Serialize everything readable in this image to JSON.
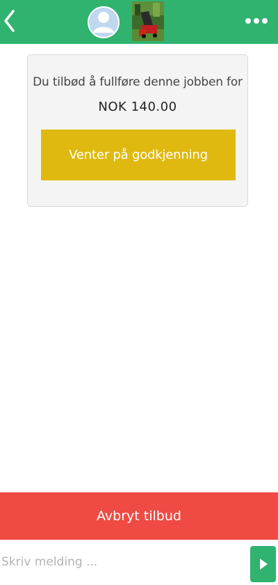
{
  "header": {
    "back_icon": "chevron-left-icon",
    "avatar_icon": "user-avatar-icon",
    "thumbnail_icon": "job-photo-thumbnail",
    "more_icon": "more-dots-icon",
    "color": "#2fb36f"
  },
  "offer": {
    "message": "Du tilbød å fullføre denne jobben for",
    "price": "NOK 140.00",
    "status_button": "Venter på godkjenning",
    "status_color": "#dfb90f"
  },
  "actions": {
    "cancel_offer": "Avbryt tilbud",
    "cancel_color": "#ef4a43"
  },
  "composer": {
    "placeholder": "Skriv melding ...",
    "value": "",
    "send_icon": "send-arrow-icon"
  }
}
